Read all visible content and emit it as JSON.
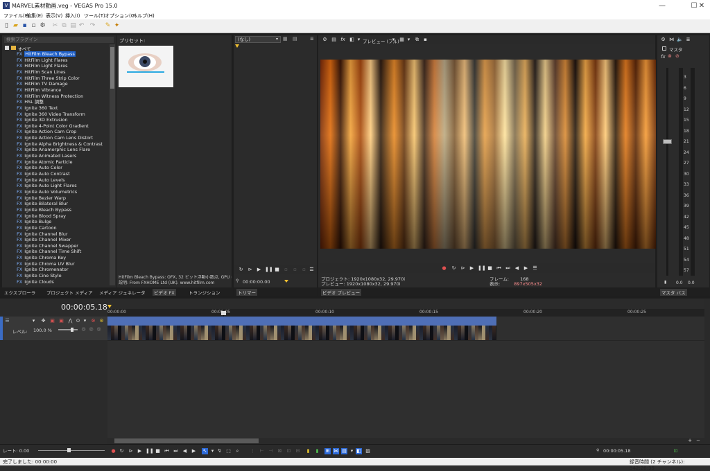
{
  "window": {
    "title": "MARVEL素材動画.veg - VEGAS Pro 15.0",
    "app_icon": "V"
  },
  "menu": [
    "ファイル(F)",
    "編集(E)",
    "表示(V)",
    "挿入(I)",
    "ツール(T)",
    "オプション(O)",
    "ヘルプ(H)"
  ],
  "explorer": {
    "search_placeholder": "検索プラグイン",
    "root": "すべて",
    "items": [
      "HitFilm Bleach Bypass",
      "HitFilm Light Flares",
      "HitFilm Light Flares",
      "HitFilm Scan Lines",
      "HitFilm Three Strip Color",
      "HitFilm TV Damage",
      "HitFilm Vibrance",
      "HitFilm Witness Protection",
      "HSL 調整",
      "Ignite 360 Text",
      "Ignite 360 Video Transform",
      "Ignite 3D Extrusion",
      "Ignite 4-Point Color Gradient",
      "Ignite Action Cam Crop",
      "Ignite Action Cam Lens Distort",
      "Ignite Alpha Brightness & Contrast",
      "Ignite Anamorphic Lens Flare",
      "Ignite Animated Lasers",
      "Ignite Atomic Particle",
      "Ignite Auto Color",
      "Ignite Auto Contrast",
      "Ignite Auto Levels",
      "Ignite Auto Light Flares",
      "Ignite Auto Volumetrics",
      "Ignite Bezier Warp",
      "Ignite Bilateral Blur",
      "Ignite Bleach Bypass",
      "Ignite Blood Spray",
      "Ignite Bulge",
      "Ignite Cartoon",
      "Ignite Channel Blur",
      "Ignite Channel Mixer",
      "Ignite Channel Swapper",
      "Ignite Channel Time Shift",
      "Ignite Chroma Key",
      "Ignite Chroma UV Blur",
      "Ignite Chromenator",
      "Ignite Cine Style",
      "Ignite Clouds"
    ],
    "selected_index": 0
  },
  "presets": {
    "label": "プリセット:"
  },
  "plugin_desc": {
    "line1": "HitFilm Bleach Bypass: OFX, 32 ビット浮動小数点, GPU に",
    "line2": "説明: From FXHOME Ltd (UK). www.hitfilm.com"
  },
  "left_tabs": [
    "エクスプローラ",
    "プロジェクト メディア",
    "メディア ジェネレータ",
    "ビデオ FX",
    "トランジション"
  ],
  "trimmer": {
    "dropdown": "(なし)",
    "time": "00:00:00.00",
    "tab": "トリマー"
  },
  "preview": {
    "quality": "プレビュー (フル)",
    "project_label": "プロジェクト:",
    "project_val": "1920x1080x32, 29.970i",
    "preview_label": "プレビュー:",
    "preview_val": "1920x1080x32, 29.970i",
    "frame_label": "フレーム:",
    "frame_val": "168",
    "display_label": "表示:",
    "display_val": "897x505x32",
    "tab": "ビデオ プレビュー"
  },
  "master": {
    "label": "マスタ",
    "tab": "マスタ バス",
    "val_l": "0.0",
    "val_r": "0.0",
    "scale": [
      "3",
      "6",
      "9",
      "12",
      "15",
      "18",
      "21",
      "24",
      "27",
      "30",
      "33",
      "36",
      "39",
      "42",
      "45",
      "48",
      "51",
      "54",
      "57"
    ]
  },
  "timeline": {
    "time": "00:00:05.18",
    "ruler": [
      "00:00:00",
      "00:00:05",
      "00:00:10",
      "00:00:15",
      "00:00:20",
      "00:00:25"
    ],
    "track_level_label": "レベル:",
    "track_level": "100.0 %",
    "rate_label": "レート:",
    "rate": "0.00",
    "end_time": "00:00:05.18"
  },
  "status": {
    "left": "完了しました: 00:00:00",
    "right": "録音時間 (2 チャンネル): 542:26:35"
  },
  "colors": {
    "accent": "#2d6ad8",
    "clip_header": "#4f6fb6",
    "meter_orange": "#f0b040"
  }
}
